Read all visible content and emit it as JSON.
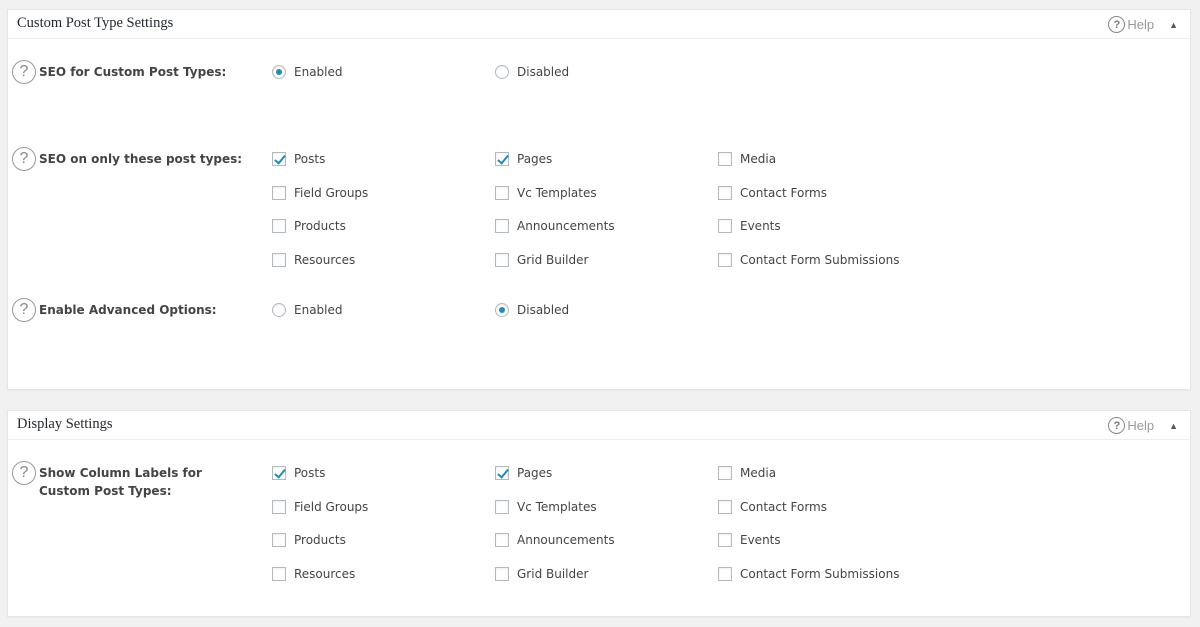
{
  "help_label": "Help",
  "panel1": {
    "title": "Custom Post Type Settings",
    "seo_cpt": {
      "label": "SEO for Custom Post Types:",
      "options": [
        "Enabled",
        "Disabled"
      ],
      "selected": "Enabled"
    },
    "seo_only": {
      "label": "SEO on only these post types:",
      "items": [
        {
          "label": "Posts",
          "checked": true
        },
        {
          "label": "Pages",
          "checked": true
        },
        {
          "label": "Media",
          "checked": false
        },
        {
          "label": "Field Groups",
          "checked": false
        },
        {
          "label": "Vc Templates",
          "checked": false
        },
        {
          "label": "Contact Forms",
          "checked": false
        },
        {
          "label": "Products",
          "checked": false
        },
        {
          "label": "Announcements",
          "checked": false
        },
        {
          "label": "Events",
          "checked": false
        },
        {
          "label": "Resources",
          "checked": false
        },
        {
          "label": "Grid Builder",
          "checked": false
        },
        {
          "label": "Contact Form Submissions",
          "checked": false
        }
      ]
    },
    "advanced": {
      "label": "Enable Advanced Options:",
      "options": [
        "Enabled",
        "Disabled"
      ],
      "selected": "Disabled"
    }
  },
  "panel2": {
    "title": "Display Settings",
    "column_labels": {
      "label": "Show Column Labels for Custom Post Types:",
      "items": [
        {
          "label": "Posts",
          "checked": true
        },
        {
          "label": "Pages",
          "checked": true
        },
        {
          "label": "Media",
          "checked": false
        },
        {
          "label": "Field Groups",
          "checked": false
        },
        {
          "label": "Vc Templates",
          "checked": false
        },
        {
          "label": "Contact Forms",
          "checked": false
        },
        {
          "label": "Products",
          "checked": false
        },
        {
          "label": "Announcements",
          "checked": false
        },
        {
          "label": "Events",
          "checked": false
        },
        {
          "label": "Resources",
          "checked": false
        },
        {
          "label": "Grid Builder",
          "checked": false
        },
        {
          "label": "Contact Form Submissions",
          "checked": false
        }
      ]
    }
  }
}
